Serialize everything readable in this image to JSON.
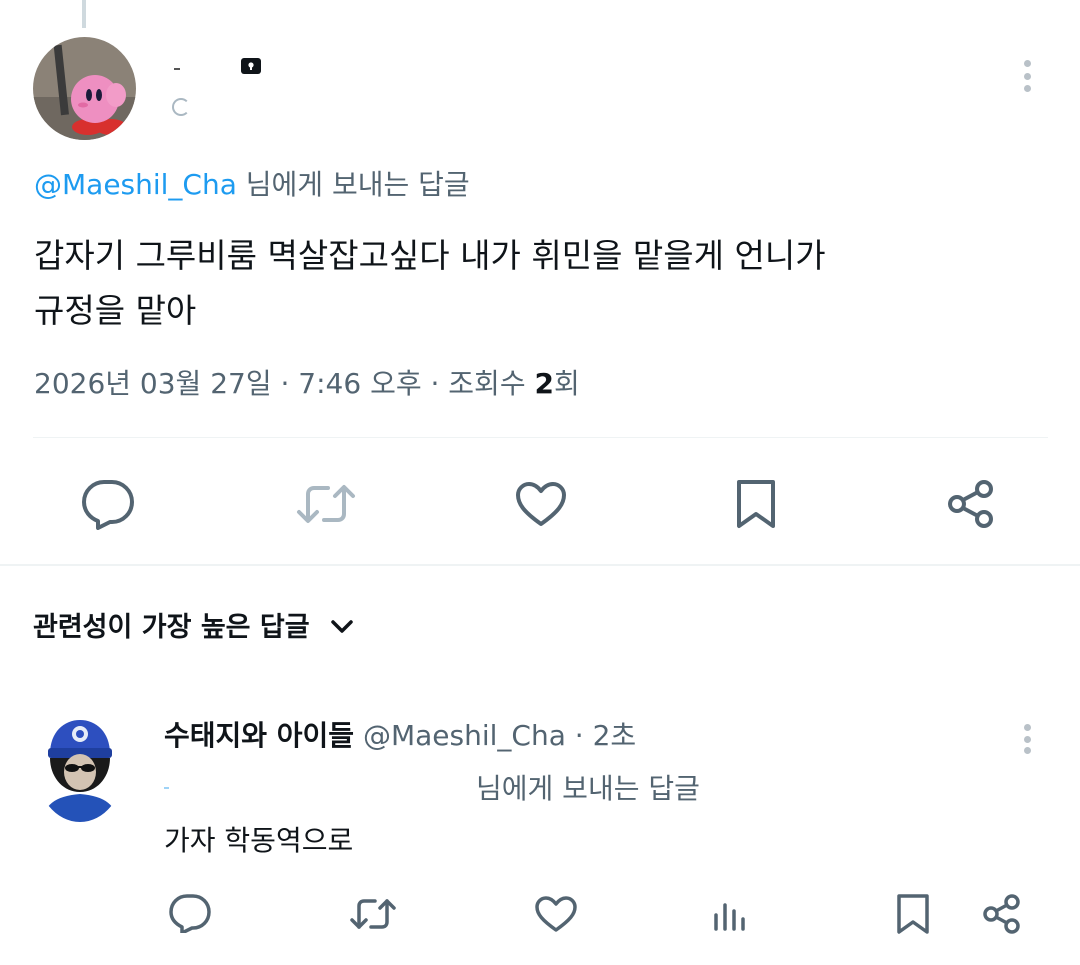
{
  "tweet": {
    "reply_to_handle": "@Maeshil_Cha",
    "reply_to_suffix": " 님에게 보내는 답글",
    "body_line1": "갑자기 그루비룸 멱살잡고싶다 내가 휘민을 맡을게 언니가",
    "body_line2": "규정을 맡아",
    "timestamp": "2026년 03월 27일 · 7:46 오후 · 조회수 ",
    "views_count": "2",
    "views_suffix": "회"
  },
  "actions": {
    "icons": [
      "reply-icon",
      "retweet-icon",
      "like-icon",
      "bookmark-icon",
      "share-icon"
    ]
  },
  "replies_section": {
    "sort_label": "관련성이 가장 높은 답글"
  },
  "reply": {
    "display_name": "수태지와 아이들",
    "handle": "@Maeshil_Cha",
    "time": " · 2초",
    "reply_to_suffix": "님에게 보내는 답글",
    "body": "가자 학동역으로"
  },
  "colors": {
    "accent": "#1d9bf0",
    "muted": "#536471",
    "icon_gray": "#536471",
    "retweet_disabled": "#aab8c2"
  }
}
